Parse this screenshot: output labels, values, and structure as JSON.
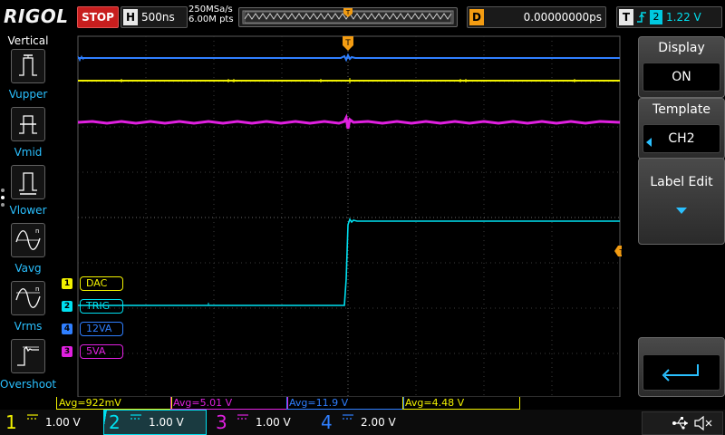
{
  "topbar": {
    "logo": "RIGOL",
    "run_state": "STOP",
    "horizontal_letter": "H",
    "timebase": "500ns",
    "sample_rate": "250MSa/s",
    "memory_depth": "6.00M pts",
    "delay_letter": "D",
    "delay_value": "0.00000000ps",
    "trigger_letter": "T",
    "trigger_edge": "rising",
    "trigger_source": "2",
    "trigger_level": "1.22 V"
  },
  "left_menu": {
    "title": "Vertical",
    "items": [
      {
        "label": "Vupper",
        "icon": "vupper-measure-icon"
      },
      {
        "label": "Vmid",
        "icon": "vmid-measure-icon"
      },
      {
        "label": "Vlower",
        "icon": "vlower-measure-icon"
      },
      {
        "label": "Vavg",
        "icon": "vavg-measure-icon"
      },
      {
        "label": "Vrms",
        "icon": "vrms-measure-icon"
      },
      {
        "label": "Overshoot",
        "icon": "overshoot-measure-icon"
      }
    ]
  },
  "channel_labels": {
    "ch1": {
      "num": "1",
      "label": "DAC",
      "color": "#f2f200"
    },
    "ch2": {
      "num": "2",
      "label": "TRIG",
      "color": "#00e0f0"
    },
    "ch4": {
      "num": "4",
      "label": "12VA",
      "color": "#2f7fff"
    },
    "ch3": {
      "num": "3",
      "label": "5VA",
      "color": "#e020e0"
    }
  },
  "right_menu": {
    "display_title": "Display",
    "display_value": "ON",
    "template_title": "Template",
    "template_value": "CH2",
    "label_edit_title": "Label Edit"
  },
  "averages": [
    {
      "text": "Avg=922mV",
      "color": "#f2f200"
    },
    {
      "text": "Avg=5.01 V",
      "color": "#e020e0"
    },
    {
      "text": "Avg=11.9 V",
      "color": "#2f7fff"
    },
    {
      "text": "Avg=4.48 V",
      "color": "#f2f200"
    }
  ],
  "bottom_channels": [
    {
      "num": "1",
      "coupling": "DC",
      "scale": "1.00 V",
      "color": "#f2f200"
    },
    {
      "num": "2",
      "coupling": "DC",
      "scale": "1.00 V",
      "color": "#00e0f0"
    },
    {
      "num": "3",
      "coupling": "DC",
      "scale": "1.00 V",
      "color": "#e020e0"
    },
    {
      "num": "4",
      "coupling": "DC",
      "scale": "2.00 V",
      "color": "#2f7fff"
    }
  ],
  "status_icons": [
    "usb-icon",
    "mute-speaker-icon"
  ],
  "colors": {
    "ch1": "#f2f200",
    "ch2": "#00e0f0",
    "ch3": "#e020e0",
    "ch4": "#2f7fff",
    "trigger_marker": "#f39c12",
    "menu_label": "#2ac0ff"
  }
}
